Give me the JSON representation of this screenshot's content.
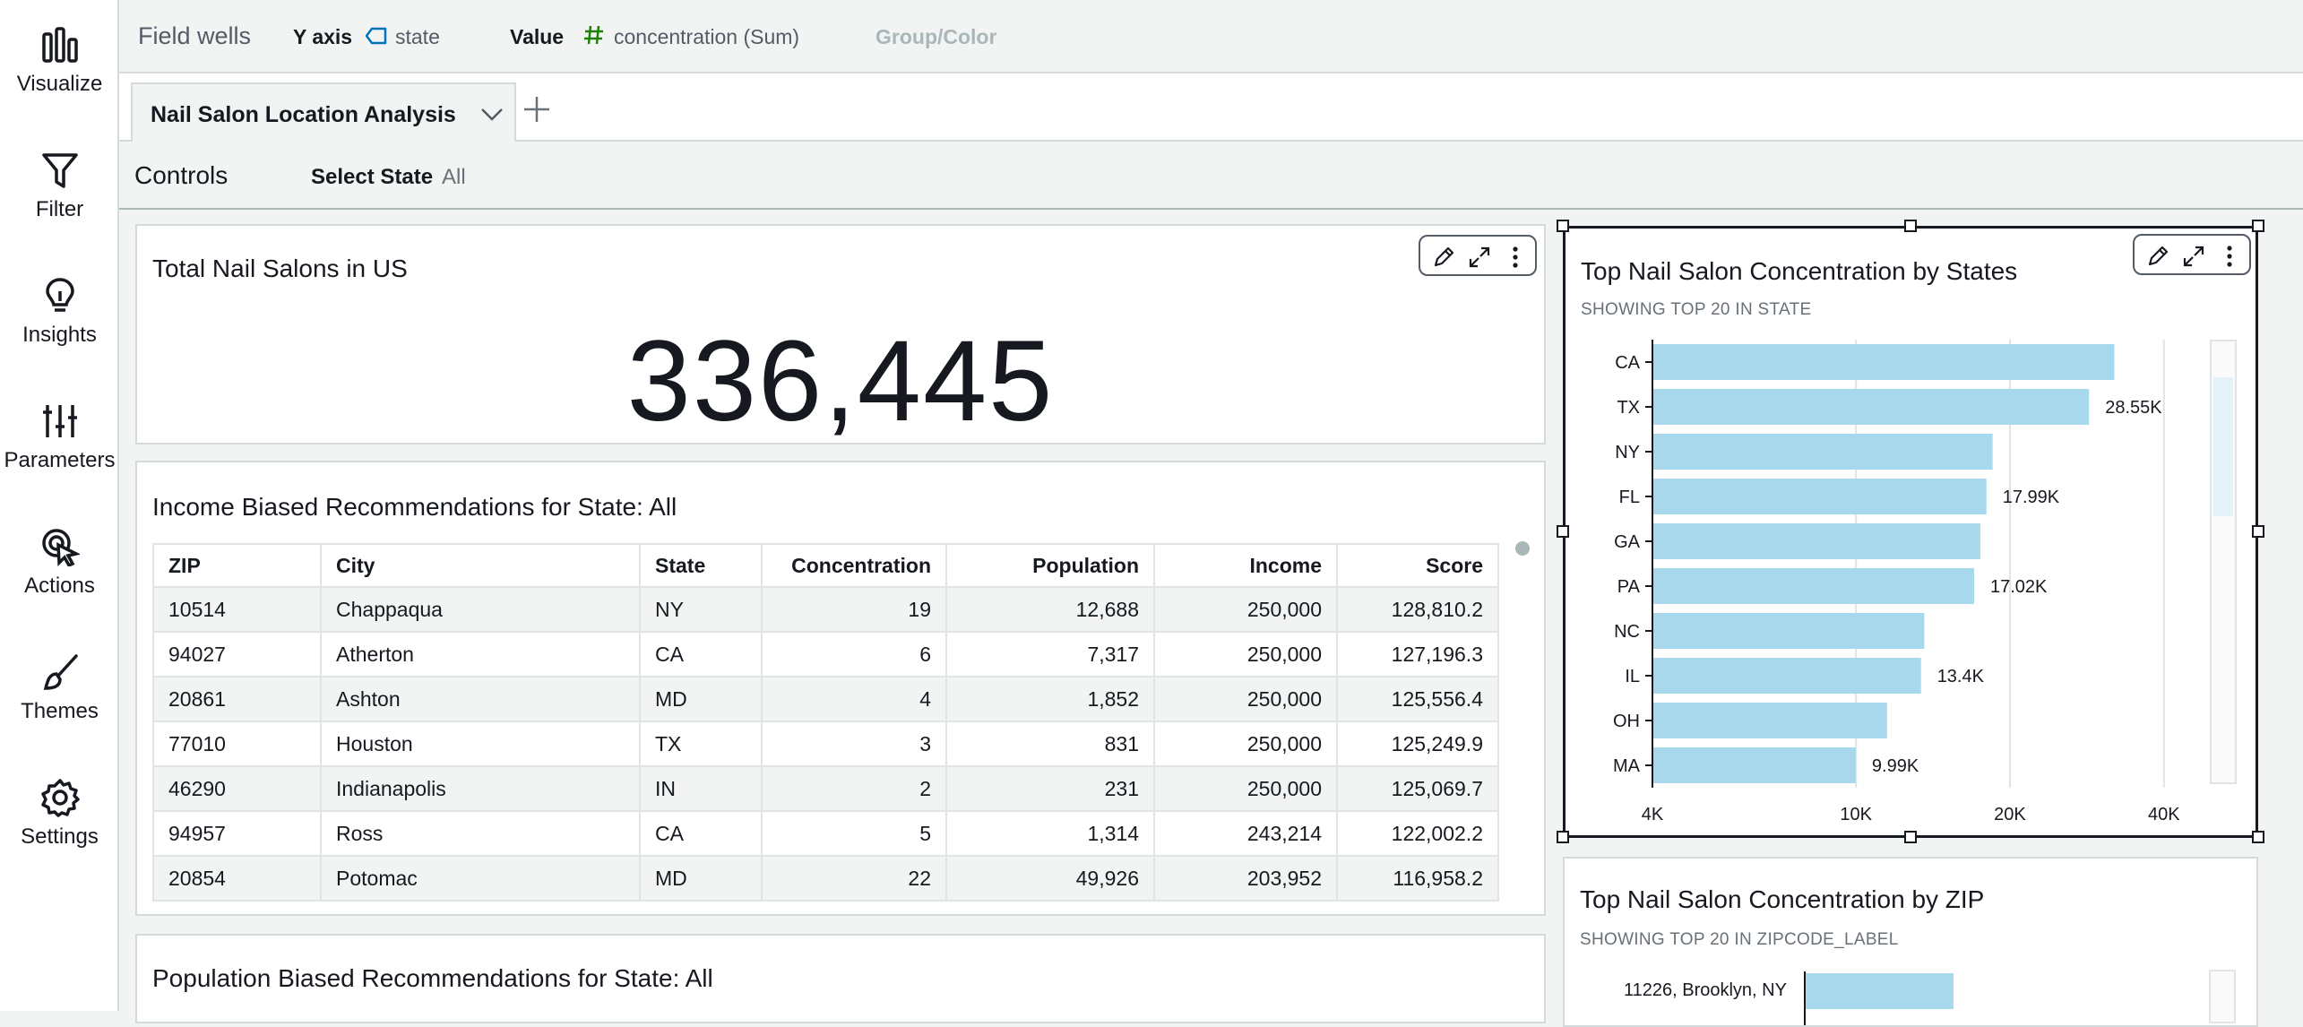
{
  "rail": {
    "items": [
      {
        "label": "Visualize",
        "icon": "bar-chart-icon"
      },
      {
        "label": "Filter",
        "icon": "filter-icon"
      },
      {
        "label": "Insights",
        "icon": "lightbulb-icon"
      },
      {
        "label": "Parameters",
        "icon": "sliders-icon"
      },
      {
        "label": "Actions",
        "icon": "cursor-click-icon"
      },
      {
        "label": "Themes",
        "icon": "brush-icon"
      },
      {
        "label": "Settings",
        "icon": "gear-icon"
      }
    ]
  },
  "field_wells": {
    "title": "Field wells",
    "y_axis_label": "Y axis",
    "y_axis_value": "state",
    "value_label": "Value",
    "value_value": "concentration (Sum)",
    "group_label": "Group/Color"
  },
  "sheet": {
    "tab_name": "Nail Salon Location Analysis"
  },
  "controls": {
    "title": "Controls",
    "select_state_label": "Select State",
    "select_state_value": "All"
  },
  "kpi": {
    "title": "Total Nail Salons in US",
    "value": "336,445"
  },
  "income_table": {
    "title": "Income Biased Recommendations for State: All",
    "columns": [
      "ZIP",
      "City",
      "State",
      "Concentration",
      "Population",
      "Income",
      "Score"
    ],
    "rows": [
      [
        "10514",
        "Chappaqua",
        "NY",
        "19",
        "12,688",
        "250,000",
        "128,810.2"
      ],
      [
        "94027",
        "Atherton",
        "CA",
        "6",
        "7,317",
        "250,000",
        "127,196.3"
      ],
      [
        "20861",
        "Ashton",
        "MD",
        "4",
        "1,852",
        "250,000",
        "125,556.4"
      ],
      [
        "77010",
        "Houston",
        "TX",
        "3",
        "831",
        "250,000",
        "125,249.9"
      ],
      [
        "46290",
        "Indianapolis",
        "IN",
        "2",
        "231",
        "250,000",
        "125,069.7"
      ],
      [
        "94957",
        "Ross",
        "CA",
        "5",
        "1,314",
        "243,214",
        "122,002.2"
      ],
      [
        "20854",
        "Potomac",
        "MD",
        "22",
        "49,926",
        "203,952",
        "116,958.2"
      ]
    ]
  },
  "population_table": {
    "title": "Population Biased Recommendations for State: All"
  },
  "chart_data": [
    {
      "type": "bar",
      "orientation": "horizontal",
      "title": "Top Nail Salon Concentration by States",
      "subtitle": "SHOWING TOP 20 IN STATE",
      "categories": [
        "CA",
        "TX",
        "NY",
        "FL",
        "GA",
        "PA",
        "NC",
        "IL",
        "OH",
        "MA"
      ],
      "values": [
        32000,
        28550,
        18500,
        17990,
        17500,
        17020,
        13600,
        13400,
        11500,
        9990
      ],
      "data_labels": [
        "",
        "28.55K",
        "",
        "17.99K",
        "",
        "17.02K",
        "",
        "13.4K",
        "",
        "9.99K"
      ],
      "x_scale": "log",
      "x_ticks": [
        4000,
        10000,
        20000,
        40000
      ],
      "x_tick_labels": [
        "4K",
        "10K",
        "20K",
        "40K"
      ],
      "xlim": [
        4000,
        45000
      ],
      "bar_color": "#a8d8ec",
      "grid": true
    },
    {
      "type": "bar",
      "orientation": "horizontal",
      "title": "Top Nail Salon Concentration by ZIP",
      "subtitle": "SHOWING TOP 20 IN ZIPCODE_LABEL",
      "categories": [
        "11226, Brooklyn, NY"
      ],
      "values": [
        null
      ],
      "bar_color": "#a8d8ec"
    }
  ]
}
